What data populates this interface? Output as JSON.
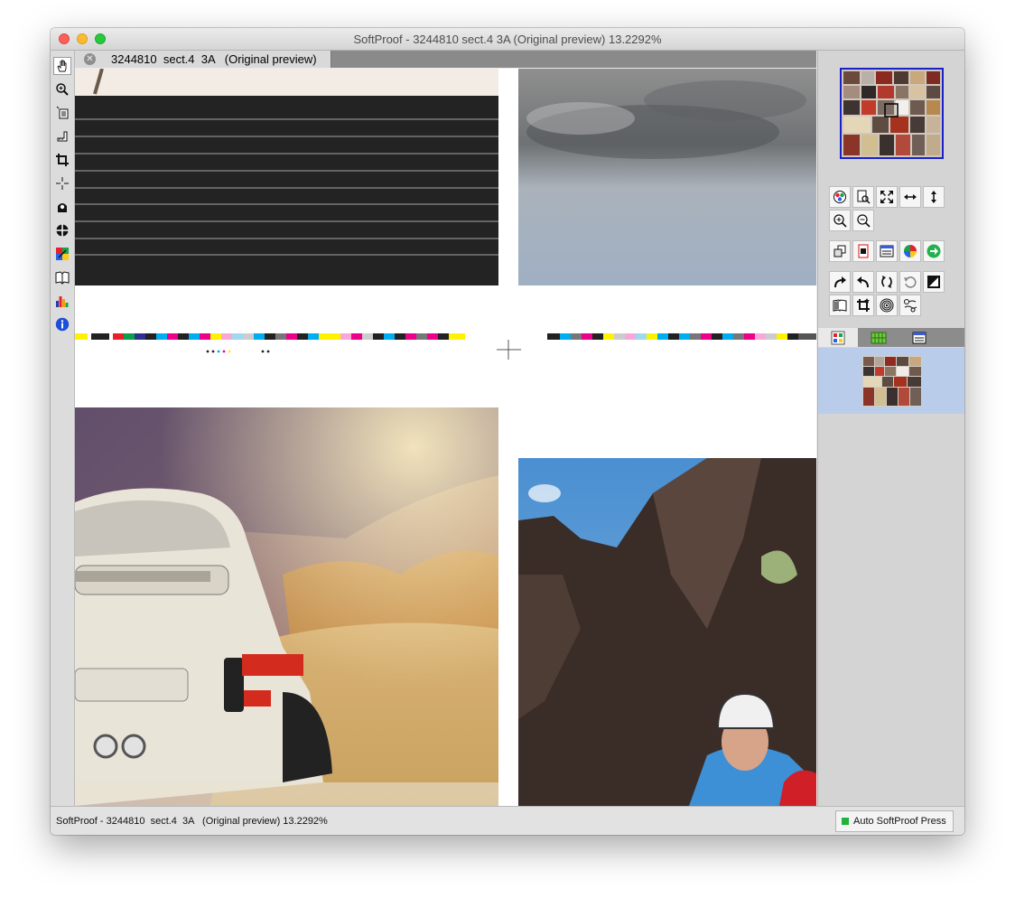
{
  "window": {
    "title": "SoftProof - 3244810  sect.4  3A   (Original preview) 13.2292%"
  },
  "tab": {
    "label": "3244810  sect.4  3A   (Original preview)"
  },
  "tools": [
    {
      "icon": "hand-icon",
      "glyph": "✋"
    },
    {
      "icon": "zoom-icon",
      "glyph": "🔍"
    },
    {
      "icon": "page-select-icon",
      "glyph": "▤"
    },
    {
      "icon": "measure-icon",
      "glyph": "⌐"
    },
    {
      "icon": "crop-icon",
      "glyph": "⌗"
    },
    {
      "icon": "crosshair-icon",
      "glyph": "+"
    },
    {
      "icon": "stamp-icon",
      "glyph": "⚙"
    },
    {
      "icon": "registration-icon",
      "glyph": "⊕"
    },
    {
      "icon": "color-picker-icon",
      "glyph": "■"
    },
    {
      "icon": "book-icon",
      "glyph": "📖"
    },
    {
      "icon": "histogram-icon",
      "glyph": "▮"
    },
    {
      "icon": "info-icon",
      "glyph": "i"
    }
  ],
  "panel_buttons": [
    {
      "icon": "color-wheel-icon",
      "glyph": "◉"
    },
    {
      "icon": "page-zoom-icon",
      "glyph": "🔍"
    },
    {
      "icon": "fit-screen-icon",
      "glyph": "⤢"
    },
    {
      "icon": "fit-width-icon",
      "glyph": "↔"
    },
    {
      "icon": "fit-height-icon",
      "glyph": "↕"
    },
    {
      "icon": "zoom-in-icon",
      "glyph": "⊕"
    },
    {
      "icon": "zoom-out-icon",
      "glyph": "⊖"
    },
    {
      "icon": "overlay-icon",
      "glyph": "❐"
    },
    {
      "icon": "page-red-icon",
      "glyph": "▯"
    },
    {
      "icon": "panel-list-icon",
      "glyph": "☰"
    },
    {
      "icon": "color-circle-icon",
      "glyph": "●"
    },
    {
      "icon": "next-green-icon",
      "glyph": "➜"
    },
    {
      "icon": "redo-icon",
      "glyph": "↷"
    },
    {
      "icon": "undo-icon",
      "glyph": "↶"
    },
    {
      "icon": "rotate-icon",
      "glyph": "⟲"
    },
    {
      "icon": "rotate-back-icon",
      "glyph": "⟲"
    },
    {
      "icon": "contrast-icon",
      "glyph": "◧"
    },
    {
      "icon": "book-open-icon",
      "glyph": "📖"
    },
    {
      "icon": "crop-star-icon",
      "glyph": "✦"
    },
    {
      "icon": "target-icon",
      "glyph": "◎"
    },
    {
      "icon": "separations-icon",
      "glyph": "≈"
    }
  ],
  "panel_tabs": [
    {
      "icon": "pages-grid-icon"
    },
    {
      "icon": "layout-green-icon"
    },
    {
      "icon": "list-window-icon"
    }
  ],
  "status": {
    "text": "SoftProof - 3244810  sect.4  3A   (Original preview) 13.2292%",
    "press_label": "Auto SoftProof Press",
    "press_color": "#21b33a"
  },
  "colors": {
    "thumb_border": "#1b20c9",
    "selection_bg": "#b9cdea"
  }
}
